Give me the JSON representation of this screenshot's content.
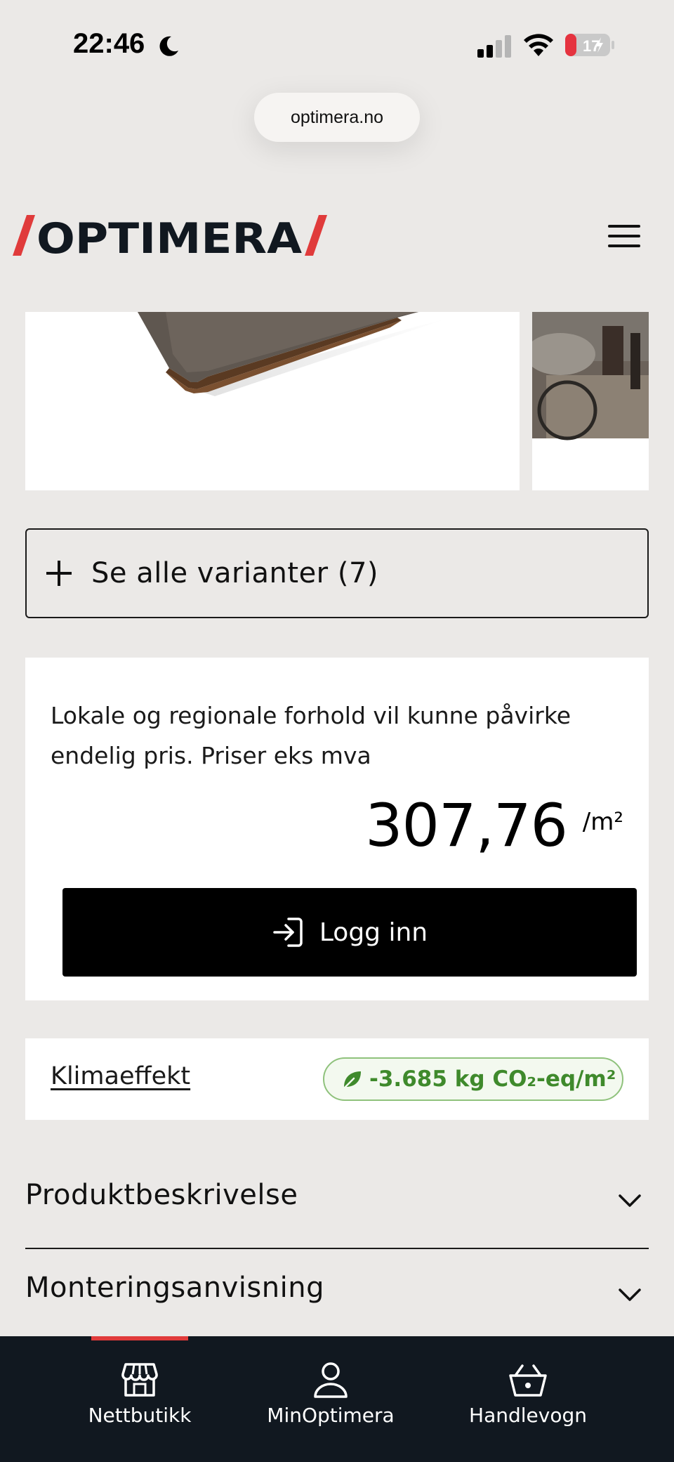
{
  "status_bar": {
    "time": "22:46",
    "battery": "17"
  },
  "browser": {
    "url": "optimera.no"
  },
  "header": {
    "logo_text": "/OPTIMERA/"
  },
  "variants": {
    "label": "Se alle varianter (7)"
  },
  "price": {
    "note": "Lokale og regionale forhold vil kunne påvirke endelig pris. Priser eks mva",
    "value": "307,76",
    "unit": "/m²",
    "login_label": "Logg inn"
  },
  "climate": {
    "link_label": "Klimaeffekt",
    "badge_text": "-3.685 kg CO₂-eq/m²"
  },
  "accordions": [
    {
      "title": "Produktbeskrivelse"
    },
    {
      "title": "Monteringsanvisning"
    }
  ],
  "bottom_nav": {
    "items": [
      {
        "label": "Nettbutikk",
        "icon": "store-icon",
        "active": true
      },
      {
        "label": "MinOptimera",
        "icon": "user-icon",
        "active": false
      },
      {
        "label": "Handlevogn",
        "icon": "basket-icon",
        "active": false
      }
    ]
  },
  "colors": {
    "brand_red": "#e03b3b",
    "nav_bg": "#111820",
    "badge_green": "#3f8a2c"
  }
}
